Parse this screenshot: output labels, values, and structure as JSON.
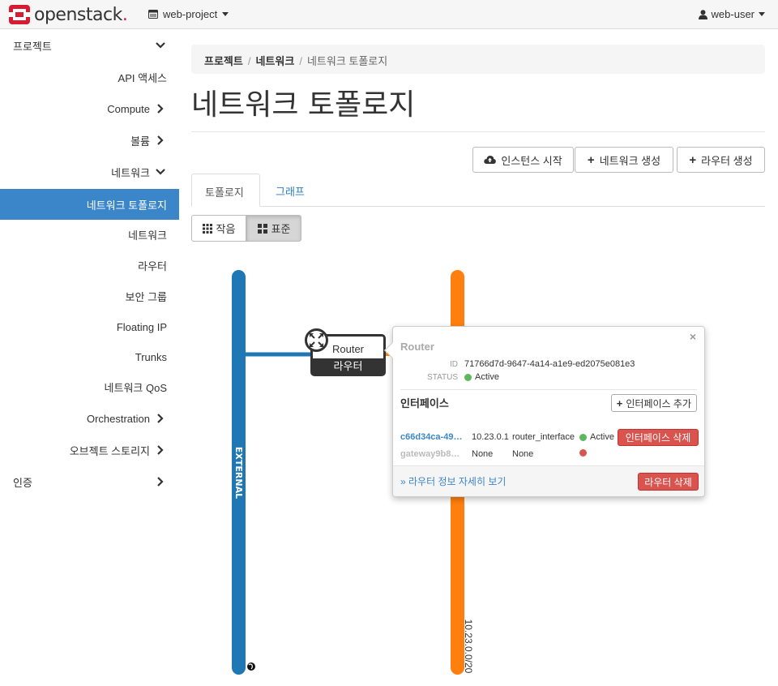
{
  "brand": {
    "name": "openstack",
    "registered": "."
  },
  "header": {
    "project": "web-project",
    "user": "web-user"
  },
  "sidebar": {
    "items": [
      {
        "label": "프로젝트"
      },
      {
        "label": "API 액세스"
      },
      {
        "label": "Compute"
      },
      {
        "label": "볼륨"
      },
      {
        "label": "네트워크"
      },
      {
        "label": "네트워크 토폴로지"
      },
      {
        "label": "네트워크"
      },
      {
        "label": "라우터"
      },
      {
        "label": "보안 그룹"
      },
      {
        "label": "Floating IP"
      },
      {
        "label": "Trunks"
      },
      {
        "label": "네트워크 QoS"
      },
      {
        "label": "Orchestration"
      },
      {
        "label": "오브젝트 스토리지"
      },
      {
        "label": "인증"
      }
    ]
  },
  "breadcrumb": {
    "items": [
      "프로젝트",
      "네트워크"
    ],
    "current": "네트워크 토폴로지"
  },
  "page_title": "네트워크 토폴로지",
  "actions": {
    "launch_instance": "인스턴스 시작",
    "create_network": "네트워크 생성",
    "create_router": "라우터 생성"
  },
  "tabs": {
    "topology": "토폴로지",
    "graph": "그래프"
  },
  "view_toggle": {
    "small": "작음",
    "normal": "표준",
    "selected": "normal"
  },
  "topology": {
    "external_network": {
      "name": "EXTERNAL",
      "color": "#1f77b4"
    },
    "internal_network": {
      "cidr": "10.23.0.0/20",
      "color": "#ff7f0e"
    },
    "router": {
      "name": "Router",
      "type": "라우터"
    },
    "port_label": "1"
  },
  "popover": {
    "title": "Router",
    "id_label": "ID",
    "id_value": "71766d7d-9647-4a14-a1e9-ed2075e081e3",
    "status_label": "STATUS",
    "status_value": "Active",
    "interfaces_heading": "인터페이스",
    "add_interface": "인터페이스 추가",
    "interfaces": [
      {
        "name": "c66d34ca-49…",
        "ip": "10.23.0.1",
        "type": "router_interface",
        "status": "Active",
        "status_color": "#5cb85c",
        "action": "인터페이스 삭제"
      },
      {
        "name": "gateway9b8…",
        "ip": "None",
        "type": "None",
        "status": "",
        "status_color": "#d9534f"
      }
    ],
    "view_details": "» 라우터 정보 자세히 보기",
    "delete_router": "라우터 삭제"
  }
}
